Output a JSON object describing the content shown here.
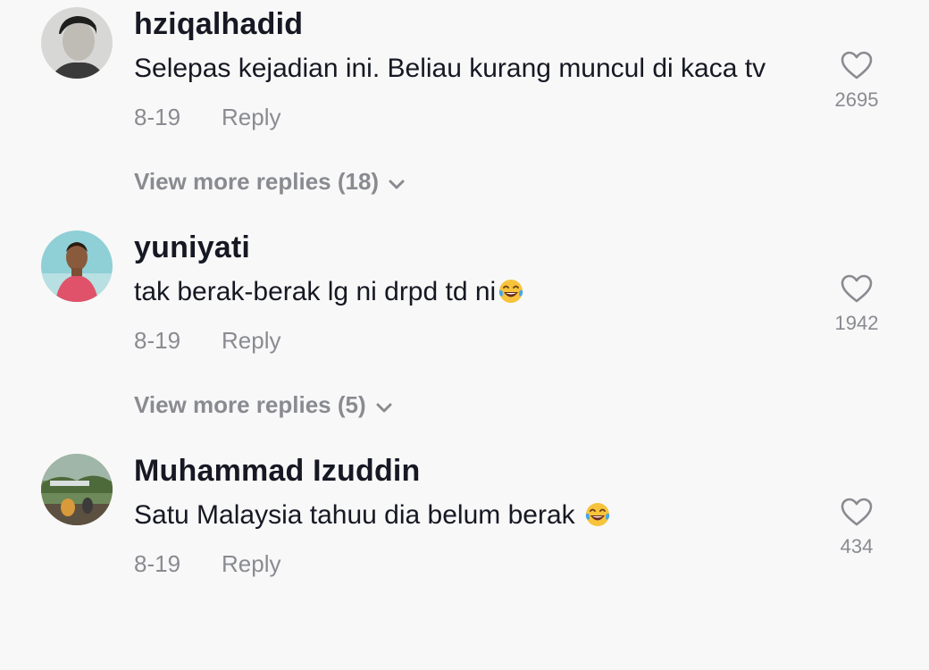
{
  "comments": [
    {
      "username": "hziqalhadid",
      "text": "Selepas kejadian ini. Beliau kurang muncul di kaca tv",
      "emoji": "",
      "date": "8-19",
      "reply_label": "Reply",
      "likes": "2695",
      "view_more": "View more replies (18)"
    },
    {
      "username": "yuniyati",
      "text": "tak berak-berak lg ni drpd td ni",
      "emoji": "face-with-tears-of-joy",
      "date": "8-19",
      "reply_label": "Reply",
      "likes": "1942",
      "view_more": "View more replies (5)"
    },
    {
      "username": "Muhammad Izuddin",
      "text": "Satu Malaysia tahuu dia belum berak ",
      "emoji": "face-with-tears-of-joy",
      "date": "8-19",
      "reply_label": "Reply",
      "likes": "434"
    }
  ],
  "colors": {
    "background": "#f8f8f8",
    "primary_text": "#161823",
    "secondary_text": "#8a8b91"
  },
  "icons": {
    "like": "heart-outline-icon",
    "expand": "chevron-down-icon",
    "emoji": "face-with-tears-of-joy"
  }
}
